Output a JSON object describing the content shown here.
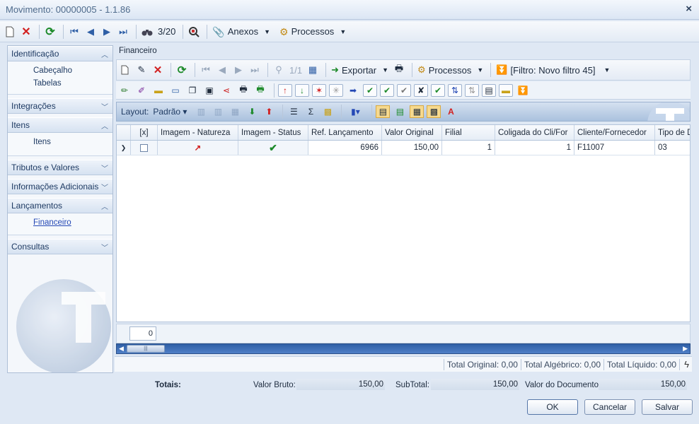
{
  "window": {
    "title": "Movimento: 00000005 - 1.1.86",
    "close_label": "×"
  },
  "main_toolbar": {
    "record_position": "3/20",
    "anexos_label": "Anexos",
    "processos_label": "Processos"
  },
  "sidebar": {
    "groups": [
      {
        "label": "Identificação",
        "expanded": true,
        "items": [
          "Cabeçalho",
          "Tabelas"
        ]
      },
      {
        "label": "Integrações",
        "expanded": false,
        "items": []
      },
      {
        "label": "Itens",
        "expanded": true,
        "items": [
          "Itens"
        ]
      },
      {
        "label": "Tributos e Valores",
        "expanded": false,
        "items": []
      },
      {
        "label": "Informações Adicionais",
        "expanded": false,
        "items": []
      },
      {
        "label": "Lançamentos",
        "expanded": true,
        "items": [
          "Financeiro"
        ]
      },
      {
        "label": "Consultas",
        "expanded": false,
        "items": []
      }
    ]
  },
  "section": {
    "title": "Financeiro",
    "toolbar": {
      "record_position": "1/1",
      "export_label": "Exportar",
      "processos_label": "Processos",
      "filter_label": "[Filtro: Novo filtro 45]"
    },
    "layout": {
      "label": "Layout:",
      "value": "Padrão"
    },
    "grid": {
      "columns": [
        "[x]",
        "Imagem - Natureza",
        "Imagem - Status",
        "Ref. Lançamento",
        "Valor Original",
        "Filial",
        "Coligada do Cli/For",
        "Cliente/Fornecedor",
        "Tipo de D"
      ],
      "rows": [
        {
          "ref": "6966",
          "valor": "150,00",
          "filial": "1",
          "coligada": "1",
          "cliente": "F11007",
          "tipo": "03"
        }
      ],
      "count": "0"
    },
    "totals": {
      "original": "Total Original: 0,00",
      "algebrico": "Total Algébrico: 0,00",
      "liquido": "Total Líquido: 0,00"
    }
  },
  "summary": {
    "totais_label": "Totais:",
    "valor_bruto_label": "Valor Bruto:",
    "valor_bruto": "150,00",
    "subtotal_label": "SubTotal:",
    "subtotal": "150,00",
    "valor_documento_label": "Valor do Documento:",
    "valor_documento": "150,00"
  },
  "buttons": {
    "ok": "OK",
    "cancel": "Cancelar",
    "save": "Salvar"
  },
  "colors": {
    "accent": "#2f5fa6",
    "link": "#2448b5",
    "red": "#d22020",
    "green": "#1d8a2a"
  }
}
